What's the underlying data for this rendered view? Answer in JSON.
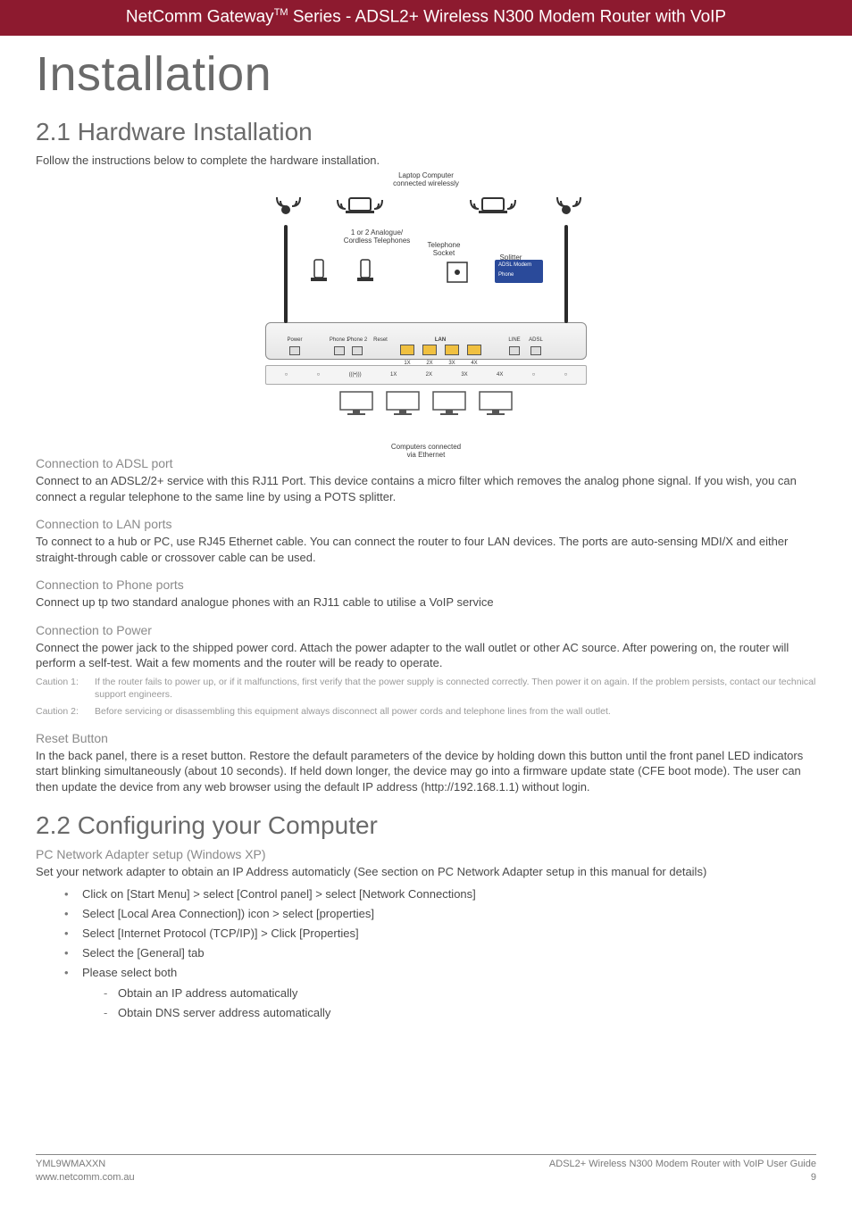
{
  "header": {
    "brand": "NetComm Gateway",
    "tm": "TM",
    "series_suffix": " Series - ADSL2+ Wireless N300 Modem Router with VoIP"
  },
  "title": "Installation",
  "section21": {
    "heading": "2.1 Hardware Installation",
    "intro": "Follow the instructions below to complete the hardware installation."
  },
  "diagram": {
    "laptop_label_l1": "Laptop Computer",
    "laptop_label_l2": "connected wirelessly",
    "phones_label_l1": "1 or 2 Analogue/",
    "phones_label_l2": "Cordless Telephones",
    "socket_label_l1": "Telephone",
    "socket_label_l2": "Socket",
    "splitter_label": "Splitter",
    "splitter_box_l1": "ADSL Modem",
    "splitter_box_l2": "Phone",
    "ports": {
      "power": "Power",
      "phone1": "Phone 1",
      "phone2": "Phone 2",
      "reset": "Reset",
      "lan": "LAN",
      "lan1": "1X",
      "lan2": "2X",
      "lan3": "3X",
      "lan4": "4X",
      "line": "LINE",
      "adsl": "ADSL"
    },
    "status_items": [
      "1X",
      "2X",
      "3X",
      "4X"
    ],
    "computers_l1": "Computers connected",
    "computers_l2": "via Ethernet"
  },
  "sections": {
    "adsl": {
      "head": "Connection to ADSL port",
      "body": "Connect to an ADSL2/2+ service with this RJ11 Port. This device contains a micro filter which removes the analog phone signal. If you wish, you can connect a regular telephone to the same line by using a POTS splitter."
    },
    "lan": {
      "head": "Connection to LAN ports",
      "body": "To connect to a hub or PC, use RJ45 Ethernet cable. You can connect the router to four LAN devices. The ports are auto-sensing MDI/X and either straight-through cable or crossover cable can be used."
    },
    "phone": {
      "head": "Connection to Phone ports",
      "body": "Connect up tp two standard analogue phones with an RJ11 cable to utilise a VoIP service"
    },
    "power": {
      "head": "Connection to Power",
      "body": "Connect the power jack to the shipped power cord. Attach the power adapter to the wall outlet or other AC source. After powering on, the router will perform a self-test. Wait a few moments and the router will be ready to operate.",
      "caution1_label": "Caution 1:",
      "caution1_text": "If the router fails to power up, or if it malfunctions, first verify that the power supply is connected correctly. Then power it on again. If the problem persists, contact our technical support engineers.",
      "caution2_label": "Caution 2:",
      "caution2_text": "Before servicing or disassembling this equipment always disconnect all power cords and telephone lines from the wall outlet."
    },
    "reset": {
      "head": "Reset Button",
      "body": "In the back panel, there is a reset button. Restore the default parameters of the device by holding down this button until the front panel LED indicators start blinking simultaneously (about 10 seconds). If held down longer, the device may go into a firmware update state (CFE boot mode). The user can then update the device from any web browser using the default IP address (http://192.168.1.1) without login."
    }
  },
  "section22": {
    "heading": "2.2 Configuring your Computer",
    "subhead": "PC Network Adapter setup (Windows XP)",
    "intro": "Set your network adapter to obtain an IP Address automaticly (See section on PC Network Adapter setup in this manual for details)",
    "steps": [
      "Click on [Start Menu] > select [Control panel] > select [Network Connections]",
      "Select [Local Area Connection]) icon > select [properties]",
      "Select [Internet Protocol (TCP/IP)] > Click [Properties]",
      "Select the [General] tab",
      "Please select both"
    ],
    "substeps": [
      "Obtain an IP address automatically",
      "Obtain DNS server address automatically"
    ]
  },
  "footer": {
    "left_l1": "YML9WMAXXN",
    "left_l2": "www.netcomm.com.au",
    "right_l1": "ADSL2+ Wireless N300 Modem Router with VoIP User Guide",
    "right_l2": "9"
  }
}
